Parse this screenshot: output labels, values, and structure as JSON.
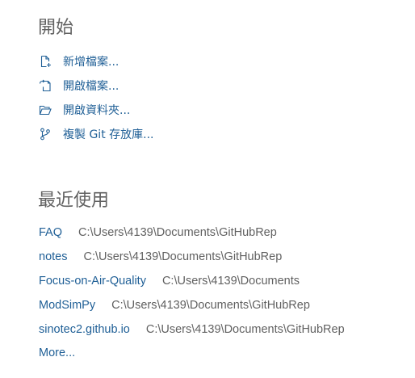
{
  "start": {
    "title": "開始",
    "items": [
      {
        "label": "新增檔案...",
        "icon": "new-file-icon"
      },
      {
        "label": "開啟檔案...",
        "icon": "open-file-icon"
      },
      {
        "label": "開啟資料夾...",
        "icon": "open-folder-icon"
      },
      {
        "label": "複製 Git 存放庫...",
        "icon": "git-branch-icon"
      }
    ]
  },
  "recent": {
    "title": "最近使用",
    "items": [
      {
        "name": "FAQ",
        "path": "C:\\Users\\4139\\Documents\\GitHubRep"
      },
      {
        "name": "notes",
        "path": "C:\\Users\\4139\\Documents\\GitHubRep"
      },
      {
        "name": "Focus-on-Air-Quality",
        "path": "C:\\Users\\4139\\Documents"
      },
      {
        "name": "ModSimPy",
        "path": "C:\\Users\\4139\\Documents\\GitHubRep"
      },
      {
        "name": "sinotec2.github.io",
        "path": "C:\\Users\\4139\\Documents\\GitHubRep"
      }
    ],
    "more_label": "More..."
  },
  "colors": {
    "link": "#1f5f96",
    "text": "#616161",
    "background": "#ffffff"
  }
}
